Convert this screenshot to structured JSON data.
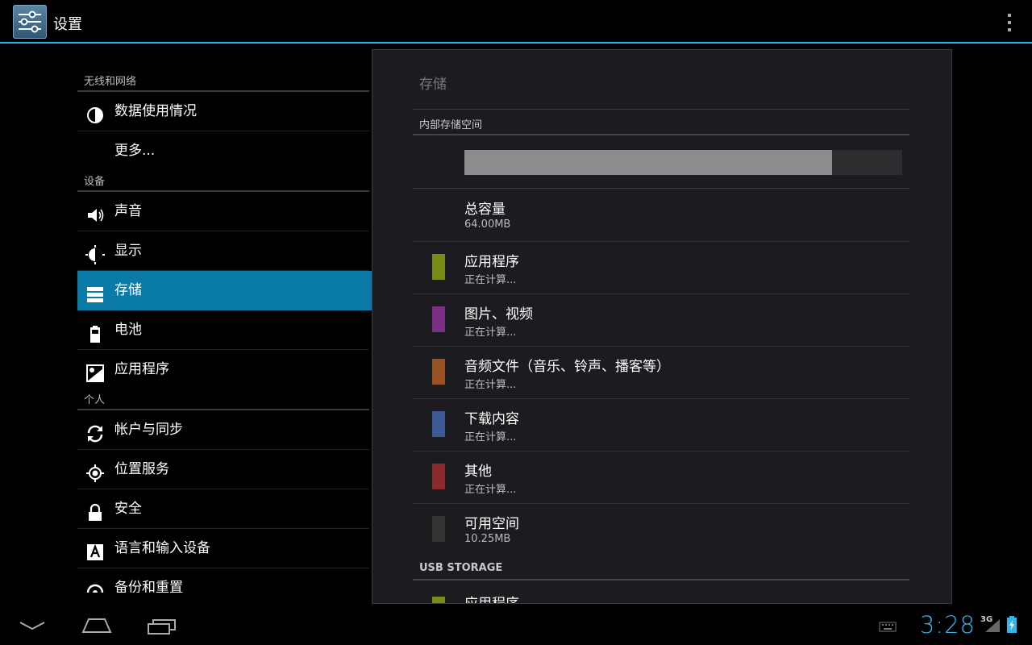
{
  "app": {
    "title": "设置"
  },
  "sidebar": {
    "sections": [
      {
        "header": "无线和网络",
        "items": [
          {
            "label": "数据使用情况",
            "icon": "data-usage-icon"
          },
          {
            "label": "更多...",
            "icon": ""
          }
        ]
      },
      {
        "header": "设备",
        "items": [
          {
            "label": "声音",
            "icon": "sound-icon"
          },
          {
            "label": "显示",
            "icon": "display-icon"
          },
          {
            "label": "存储",
            "icon": "storage-icon",
            "selected": true
          },
          {
            "label": "电池",
            "icon": "battery-icon"
          },
          {
            "label": "应用程序",
            "icon": "apps-icon"
          }
        ]
      },
      {
        "header": "个人",
        "items": [
          {
            "label": "帐户与同步",
            "icon": "sync-icon"
          },
          {
            "label": "位置服务",
            "icon": "location-icon"
          },
          {
            "label": "安全",
            "icon": "lock-icon"
          },
          {
            "label": "语言和输入设备",
            "icon": "language-icon"
          },
          {
            "label": "备份和重置",
            "icon": "backup-icon"
          }
        ]
      }
    ]
  },
  "storage": {
    "title": "存储",
    "internal_header": "内部存储空间",
    "used_fraction": 0.84,
    "rows": [
      {
        "title": "总容量",
        "sub": "64.00MB",
        "color": ""
      },
      {
        "title": "应用程序",
        "sub": "正在计算...",
        "color": "#7b8a16"
      },
      {
        "title": "图片、视频",
        "sub": "正在计算...",
        "color": "#7b2f85"
      },
      {
        "title": "音频文件（音乐、铃声、播客等）",
        "sub": "正在计算...",
        "color": "#9a5225"
      },
      {
        "title": "下载内容",
        "sub": "正在计算...",
        "color": "#3d5a96"
      },
      {
        "title": "其他",
        "sub": "正在计算...",
        "color": "#8a2a2a"
      },
      {
        "title": "可用空间",
        "sub": "10.25MB",
        "color": "#333333"
      }
    ],
    "usb_header": "USB STORAGE",
    "usb_partial_row": "应用程序"
  },
  "status": {
    "time": "3:28",
    "network": "3G",
    "accent": "#33b5e5"
  }
}
